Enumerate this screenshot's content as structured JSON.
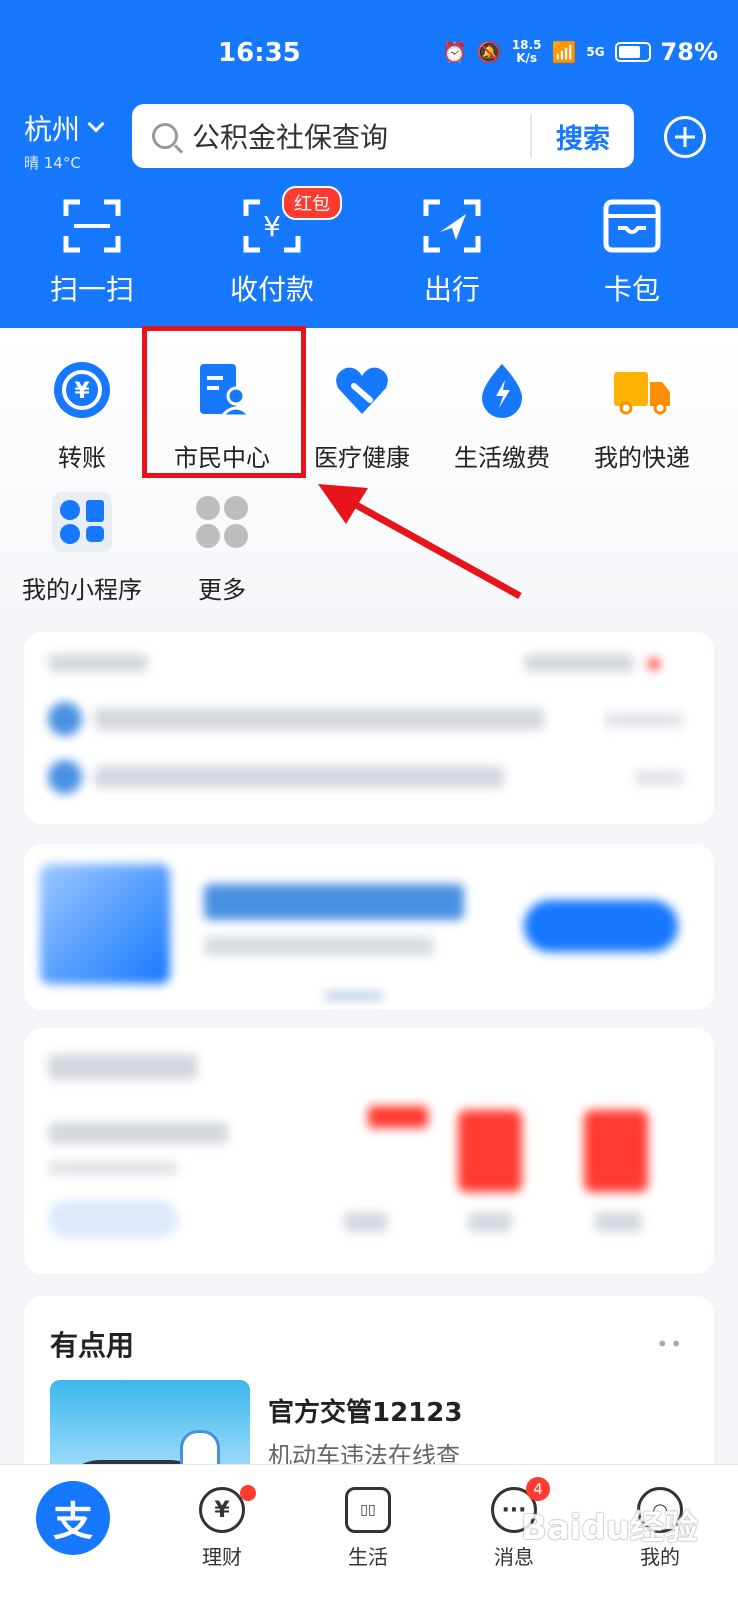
{
  "status": {
    "time": "16:35",
    "net_speed": "18.5",
    "net_unit": "K/s",
    "signal": "5G",
    "battery": "78%",
    "battery_level": 0.78
  },
  "header": {
    "city": "杭州",
    "weather": "晴 14°C",
    "search_placeholder": "公积金社保查询",
    "search_button": "搜索",
    "red_badge": "红包"
  },
  "quick_actions": [
    {
      "label": "扫一扫",
      "icon": "scan-icon"
    },
    {
      "label": "收付款",
      "icon": "payment-icon"
    },
    {
      "label": "出行",
      "icon": "travel-icon"
    },
    {
      "label": "卡包",
      "icon": "card-wallet-icon"
    }
  ],
  "services": [
    {
      "label": "转账",
      "icon": "transfer-icon"
    },
    {
      "label": "市民中心",
      "icon": "citizen-center-icon"
    },
    {
      "label": "医疗健康",
      "icon": "health-icon"
    },
    {
      "label": "生活缴费",
      "icon": "utility-icon"
    },
    {
      "label": "我的快递",
      "icon": "express-icon"
    },
    {
      "label": "我的小程序",
      "icon": "mini-program-icon"
    },
    {
      "label": "更多",
      "icon": "more-icon"
    }
  ],
  "useful": {
    "title": "有点用",
    "item_title": "官方交管12123",
    "item_sub": "机动车违法在线查"
  },
  "tabs": [
    {
      "label": "",
      "icon": "alipay-home-icon",
      "glyph": "支"
    },
    {
      "label": "理财",
      "icon": "wealth-icon",
      "glyph": "¥"
    },
    {
      "label": "生活",
      "icon": "life-icon",
      "glyph": ""
    },
    {
      "label": "消息",
      "icon": "message-icon",
      "glyph": "···",
      "badge": "4"
    },
    {
      "label": "我的",
      "icon": "profile-icon",
      "glyph": ""
    }
  ],
  "watermark": "Baidu经验"
}
